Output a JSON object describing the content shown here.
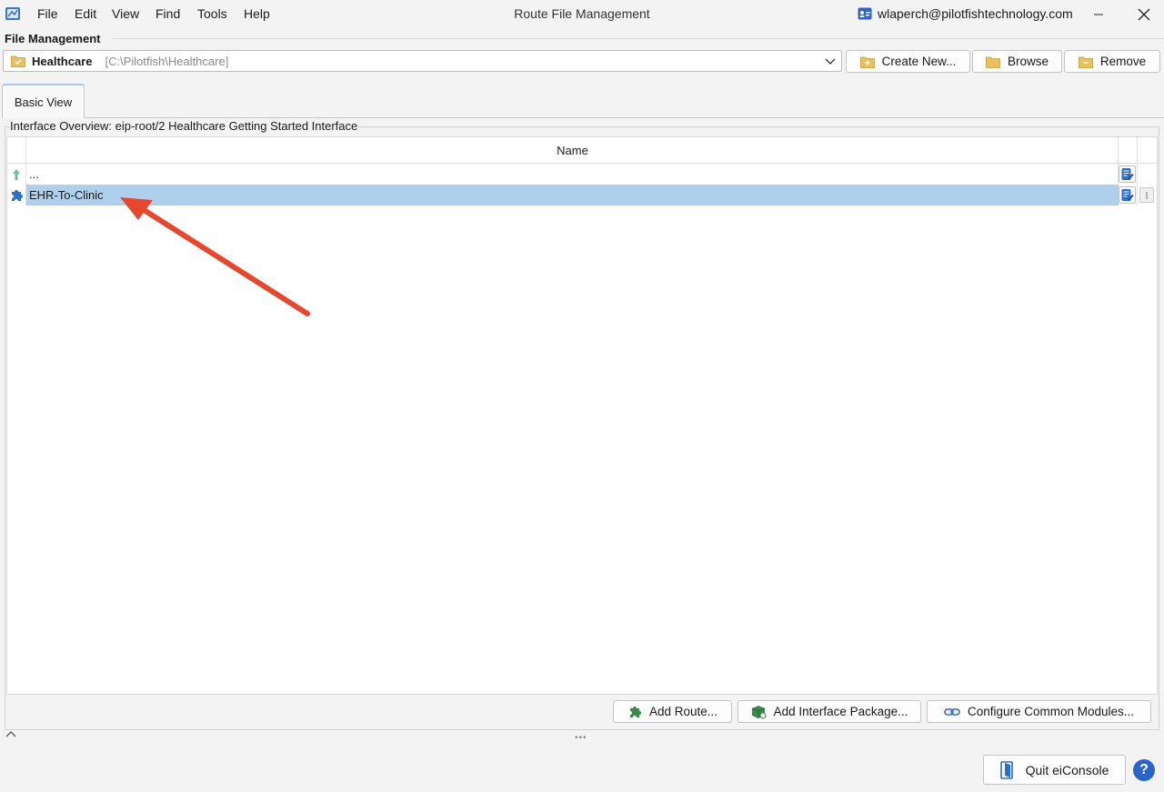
{
  "window": {
    "title": "Route File Management",
    "user_email": "wlaperch@pilotfishtechnology.com"
  },
  "menu": {
    "items": [
      "File",
      "Edit",
      "View",
      "Find",
      "Tools",
      "Help"
    ]
  },
  "file_management": {
    "section_title": "File Management",
    "workspace_name": "Healthcare",
    "workspace_path": "[C:\\Pilotfish\\Healthcare]",
    "create_new_label": "Create New...",
    "browse_label": "Browse",
    "remove_label": "Remove"
  },
  "tabs": [
    {
      "label": "Basic View",
      "selected": true
    }
  ],
  "overview": {
    "legend": "Interface Overview: eip-root/2 Healthcare Getting Started Interface",
    "column_name": "Name",
    "rows": [
      {
        "label": "...",
        "icon": "up-arrow-icon",
        "selected": false
      },
      {
        "label": "EHR-To-Clinic",
        "icon": "puzzle-route-icon",
        "selected": true
      }
    ]
  },
  "actions": {
    "add_route_label": "Add Route...",
    "add_interface_package_label": "Add Interface Package...",
    "configure_common_modules_label": "Configure Common Modules..."
  },
  "footer": {
    "quit_label": "Quit eiConsole",
    "help_label": "?"
  },
  "colors": {
    "selection": "#aed0ed",
    "annotation_arrow": "#e5482e",
    "accent_blue": "#2c63c9"
  }
}
